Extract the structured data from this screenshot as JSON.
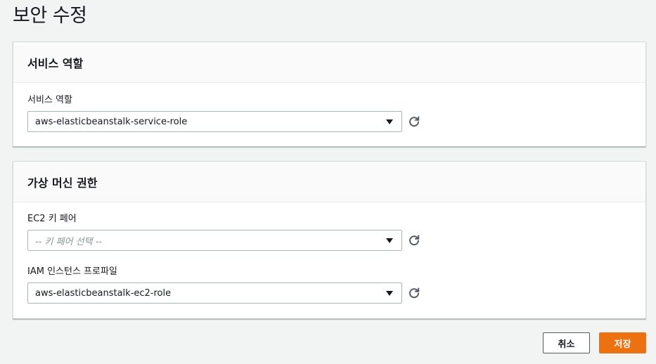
{
  "page": {
    "title": "보안 수정"
  },
  "service_role_panel": {
    "heading": "서비스 역할",
    "field_label": "서비스 역할",
    "value": "aws-elasticbeanstalk-service-role"
  },
  "vm_permissions_panel": {
    "heading": "가상 머신 권한",
    "key_pair": {
      "label": "EC2 키 페어",
      "placeholder": "-- 키 페어 선택 --"
    },
    "instance_profile": {
      "label": "IAM 인스턴스 프로파일",
      "value": "aws-elasticbeanstalk-ec2-role"
    }
  },
  "actions": {
    "cancel_label": "취소",
    "save_label": "저장"
  },
  "colors": {
    "primary": "#ec7211",
    "background": "#f2f3f3"
  },
  "icons": {
    "refresh": "refresh-icon",
    "dropdown": "caret-down-icon"
  }
}
